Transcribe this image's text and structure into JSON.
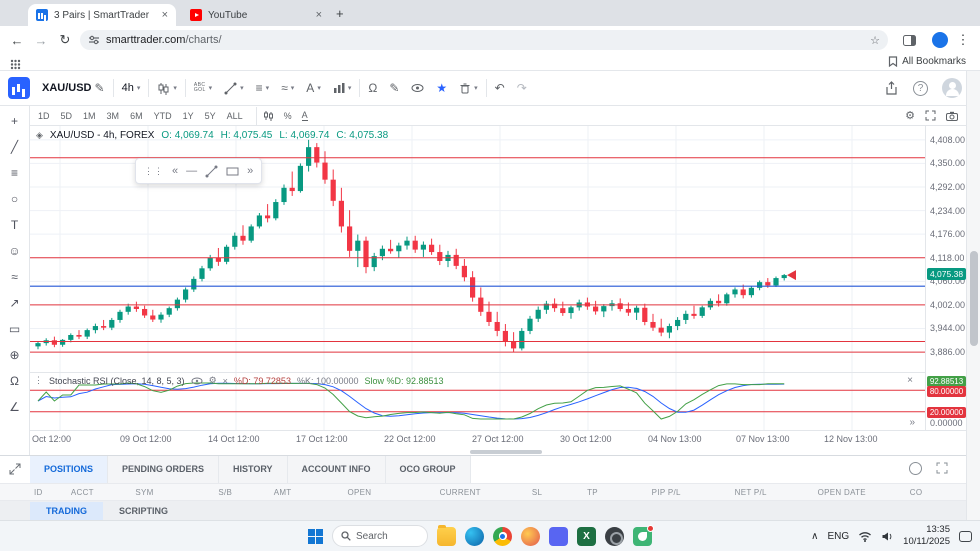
{
  "browser": {
    "tab1": "3 Pairs | SmartTrader",
    "tab2": "YouTube",
    "url_domain": "smarttrader.com",
    "url_path": "/charts/",
    "all_bookmarks": "All Bookmarks"
  },
  "header": {
    "symbol": "XAU/USD",
    "interval": "4h",
    "compare_line1": "ABC",
    "compare_line2": "GOL"
  },
  "quickbar": {
    "ranges": [
      "1D",
      "5D",
      "1M",
      "3M",
      "6M",
      "YTD",
      "1Y",
      "5Y",
      "ALL"
    ],
    "percent": "%",
    "auto": "A"
  },
  "chart": {
    "legend_symbol": "XAU/USD - 4h, FOREX",
    "legend_o": "O: 4,069.74",
    "legend_h": "H: 4,075.45",
    "legend_l": "L: 4,069.74",
    "legend_c": "C: 4,075.38",
    "price_axis": [
      "4,408.00",
      "4,350.00",
      "4,292.00",
      "4,234.00",
      "4,176.00",
      "4,118.00",
      "4,060.00",
      "4,002.00",
      "3,944.00",
      "3,886.00"
    ],
    "current_price": "4,075.38"
  },
  "stoch": {
    "title": "Stochastic RSI (Close, 14, 8, 5, 3)",
    "d_label": "%D: 79.72853",
    "k_label": "%K: 100.00000",
    "slow_label": "Slow %D: 92.88513",
    "axis_slow": "92.88513",
    "axis_hi": "80.00000",
    "axis_lo": "20.00000",
    "axis_zero": "0.00000"
  },
  "panel": {
    "tabs": [
      "POSITIONS",
      "PENDING ORDERS",
      "HISTORY",
      "ACCOUNT INFO",
      "OCO GROUP"
    ],
    "columns": [
      "ID",
      "ACCT",
      "SYM",
      "S/B",
      "AMT",
      "OPEN",
      "CURRENT",
      "SL",
      "TP",
      "PIP P/L",
      "NET P/L",
      "OPEN DATE",
      "CO"
    ],
    "bottom_tabs": [
      "TRADING",
      "SCRIPTING"
    ]
  },
  "taskbar": {
    "search_label": "Search",
    "lang": "ENG",
    "time": "13:35",
    "date": "10/11/2025"
  },
  "colors": {
    "up": "#089981",
    "down": "#f23645",
    "line_red": "#e3343e",
    "line_blue": "#2457d6",
    "accent_blue": "#1369d9",
    "stoch_fast": "#43a047",
    "stoch_slow": "#2962ff"
  },
  "chart_data": {
    "type": "candlestick",
    "symbol": "XAU/USD",
    "interval": "4h",
    "ylim": [
      3837,
      4442
    ],
    "price_ticks": [
      4408,
      4350,
      4292,
      4234,
      4176,
      4118,
      4060,
      4002,
      3944,
      3886
    ],
    "red_lines": [
      4364,
      4118,
      4002,
      3912,
      3886
    ],
    "blue_line": 4048,
    "last_price": 4075.38,
    "dates": [
      "Oct 12:00",
      "09 Oct 12:00",
      "14 Oct 12:00",
      "17 Oct 12:00",
      "22 Oct 12:00",
      "27 Oct 12:00",
      "30 Oct 12:00",
      "04 Nov 13:00",
      "07 Nov 13:00",
      "12 Nov 13:00"
    ],
    "stoch_levels": [
      80,
      20
    ],
    "stoch_last": {
      "d": 79.72853,
      "k": 100.0,
      "slow_d": 92.88513
    },
    "candles": [
      [
        3900,
        3912,
        3893,
        3908
      ],
      [
        3908,
        3920,
        3902,
        3915
      ],
      [
        3915,
        3924,
        3898,
        3904
      ],
      [
        3904,
        3918,
        3899,
        3916
      ],
      [
        3916,
        3932,
        3910,
        3928
      ],
      [
        3928,
        3940,
        3918,
        3924
      ],
      [
        3924,
        3944,
        3918,
        3940
      ],
      [
        3940,
        3956,
        3932,
        3950
      ],
      [
        3950,
        3965,
        3940,
        3946
      ],
      [
        3946,
        3970,
        3940,
        3965
      ],
      [
        3965,
        3990,
        3958,
        3985
      ],
      [
        3985,
        4005,
        3978,
        3998
      ],
      [
        3998,
        4010,
        3985,
        3992
      ],
      [
        3992,
        4000,
        3970,
        3976
      ],
      [
        3976,
        3990,
        3960,
        3966
      ],
      [
        3966,
        3984,
        3958,
        3978
      ],
      [
        3978,
        3998,
        3972,
        3994
      ],
      [
        3994,
        4020,
        3988,
        4015
      ],
      [
        4015,
        4045,
        4008,
        4040
      ],
      [
        4040,
        4072,
        4034,
        4066
      ],
      [
        4066,
        4098,
        4060,
        4092
      ],
      [
        4092,
        4125,
        4086,
        4118
      ],
      [
        4118,
        4142,
        4098,
        4108
      ],
      [
        4108,
        4150,
        4102,
        4145
      ],
      [
        4145,
        4180,
        4138,
        4172
      ],
      [
        4172,
        4198,
        4150,
        4160
      ],
      [
        4160,
        4200,
        4155,
        4195
      ],
      [
        4195,
        4228,
        4190,
        4222
      ],
      [
        4222,
        4250,
        4205,
        4215
      ],
      [
        4215,
        4262,
        4210,
        4255
      ],
      [
        4255,
        4298,
        4248,
        4290
      ],
      [
        4290,
        4330,
        4270,
        4282
      ],
      [
        4282,
        4350,
        4278,
        4344
      ],
      [
        4344,
        4408,
        4330,
        4390
      ],
      [
        4390,
        4400,
        4340,
        4352
      ],
      [
        4352,
        4380,
        4300,
        4310
      ],
      [
        4310,
        4335,
        4245,
        4258
      ],
      [
        4258,
        4290,
        4180,
        4195
      ],
      [
        4195,
        4235,
        4120,
        4135
      ],
      [
        4135,
        4175,
        4095,
        4160
      ],
      [
        4160,
        4170,
        4080,
        4095
      ],
      [
        4095,
        4130,
        4085,
        4122
      ],
      [
        4122,
        4148,
        4112,
        4140
      ],
      [
        4140,
        4162,
        4128,
        4134
      ],
      [
        4134,
        4155,
        4118,
        4148
      ],
      [
        4148,
        4170,
        4138,
        4160
      ],
      [
        4160,
        4172,
        4130,
        4138
      ],
      [
        4138,
        4158,
        4120,
        4150
      ],
      [
        4150,
        4165,
        4125,
        4132
      ],
      [
        4132,
        4150,
        4100,
        4110
      ],
      [
        4110,
        4135,
        4095,
        4125
      ],
      [
        4125,
        4140,
        4090,
        4098
      ],
      [
        4098,
        4115,
        4060,
        4070
      ],
      [
        4070,
        4085,
        4010,
        4020
      ],
      [
        4020,
        4045,
        3975,
        3985
      ],
      [
        3985,
        4010,
        3950,
        3960
      ],
      [
        3960,
        3985,
        3925,
        3938
      ],
      [
        3938,
        3955,
        3900,
        3912
      ],
      [
        3912,
        3935,
        3886,
        3895
      ],
      [
        3895,
        3945,
        3890,
        3938
      ],
      [
        3938,
        3975,
        3930,
        3968
      ],
      [
        3968,
        3998,
        3960,
        3990
      ],
      [
        3990,
        4012,
        3980,
        4005
      ],
      [
        4005,
        4018,
        3985,
        3994
      ],
      [
        3994,
        4010,
        3975,
        3982
      ],
      [
        3982,
        4000,
        3968,
        3996
      ],
      [
        3996,
        4015,
        3988,
        4008
      ],
      [
        4008,
        4020,
        3990,
        3998
      ],
      [
        3998,
        4012,
        3978,
        3986
      ],
      [
        3986,
        4004,
        3972,
        3999
      ],
      [
        3999,
        4014,
        3988,
        4006
      ],
      [
        4006,
        4018,
        3986,
        3992
      ],
      [
        3992,
        4008,
        3975,
        3983
      ],
      [
        3983,
        4000,
        3965,
        3995
      ],
      [
        3995,
        4005,
        3952,
        3960
      ],
      [
        3960,
        3980,
        3938,
        3946
      ],
      [
        3946,
        3968,
        3925,
        3934
      ],
      [
        3934,
        3956,
        3920,
        3950
      ],
      [
        3950,
        3972,
        3940,
        3965
      ],
      [
        3965,
        3988,
        3955,
        3980
      ],
      [
        3980,
        4000,
        3968,
        3975
      ],
      [
        3975,
        4000,
        3970,
        3996
      ],
      [
        3996,
        4018,
        3990,
        4012
      ],
      [
        4012,
        4028,
        3998,
        4006
      ],
      [
        4006,
        4032,
        4000,
        4028
      ],
      [
        4028,
        4045,
        4020,
        4040
      ],
      [
        4040,
        4052,
        4018,
        4026
      ],
      [
        4026,
        4048,
        4020,
        4044
      ],
      [
        4044,
        4062,
        4038,
        4058
      ],
      [
        4058,
        4068,
        4044,
        4050
      ],
      [
        4050,
        4072,
        4046,
        4068
      ],
      [
        4068,
        4078,
        4062,
        4075.38
      ]
    ]
  }
}
